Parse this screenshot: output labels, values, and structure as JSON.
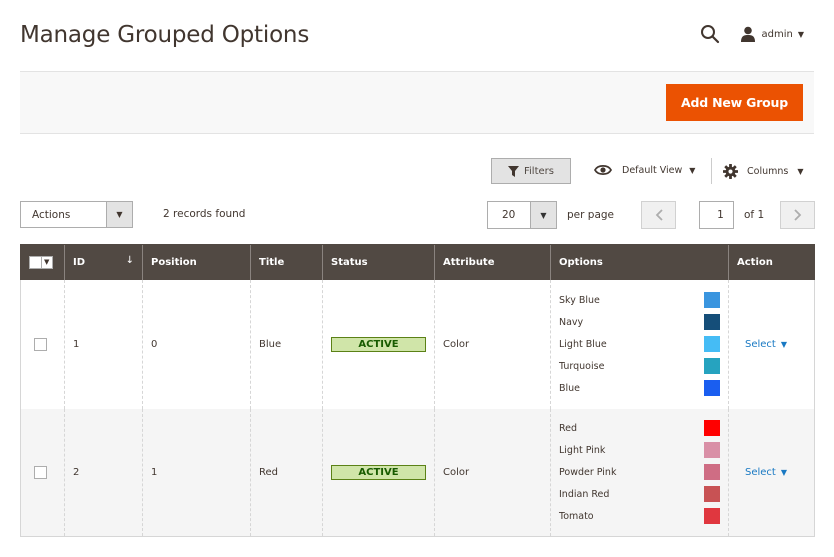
{
  "header": {
    "title": "Manage Grouped Options",
    "user": "admin",
    "search_icon": "search-icon",
    "user_icon": "user-icon"
  },
  "toolbar": {
    "add_new_label": "Add New Group",
    "accent_color": "#eb5202"
  },
  "controls": {
    "filters_label": "Filters",
    "view_label": "Default View",
    "columns_label": "Columns",
    "actions_label": "Actions",
    "records_found": "2 records found",
    "per_page_value": "20",
    "per_page_label": "per page",
    "current_page": "1",
    "page_of": "of 1"
  },
  "grid": {
    "columns": [
      "ID",
      "Position",
      "Title",
      "Status",
      "Attribute",
      "Options",
      "Action"
    ],
    "header_bg": "#514943",
    "rows": [
      {
        "id": "1",
        "position": "0",
        "title": "Blue",
        "status": "ACTIVE",
        "attribute": "Color",
        "action": "Select",
        "options": [
          {
            "name": "Sky Blue",
            "color": "#3a95df"
          },
          {
            "name": "Navy",
            "color": "#154e79"
          },
          {
            "name": "Light Blue",
            "color": "#45bcf5"
          },
          {
            "name": "Turquoise",
            "color": "#26a3bf"
          },
          {
            "name": "Blue",
            "color": "#1a5ef0"
          }
        ]
      },
      {
        "id": "2",
        "position": "1",
        "title": "Red",
        "status": "ACTIVE",
        "attribute": "Color",
        "action": "Select",
        "options": [
          {
            "name": "Red",
            "color": "#ff0000"
          },
          {
            "name": "Light Pink",
            "color": "#d98fa6"
          },
          {
            "name": "Powder Pink",
            "color": "#cf6d84"
          },
          {
            "name": "Indian Red",
            "color": "#c85254"
          },
          {
            "name": "Tomato",
            "color": "#e0373f"
          }
        ]
      }
    ]
  }
}
